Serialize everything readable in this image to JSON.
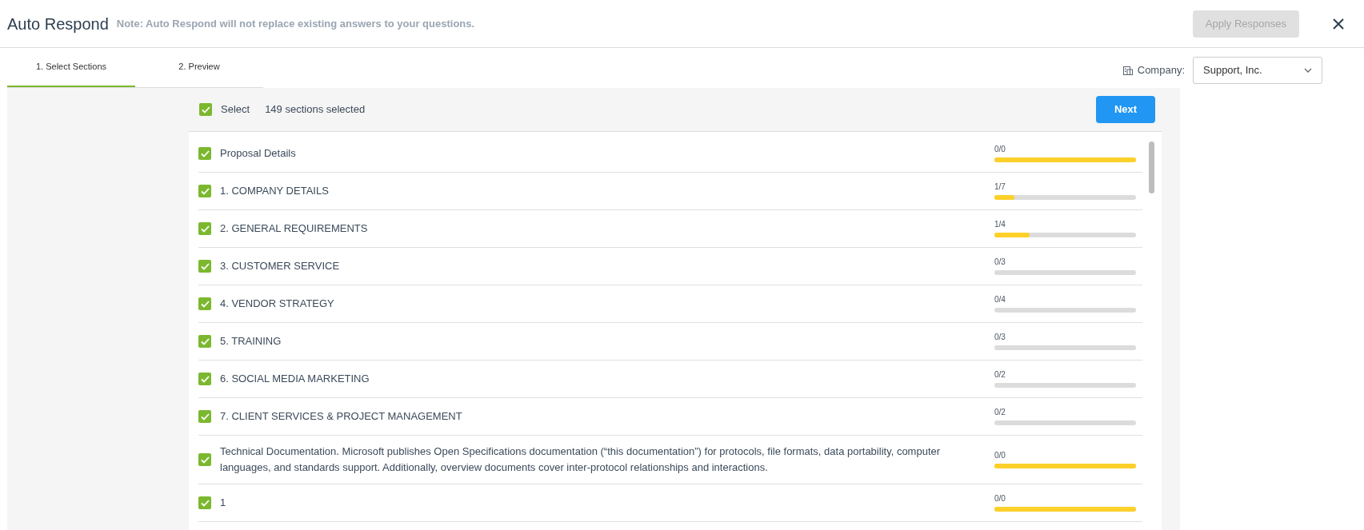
{
  "header": {
    "title": "Auto Respond",
    "note": "Note: Auto Respond will not replace existing answers to your questions.",
    "apply_button": {
      "label": "Apply Responses",
      "disabled": true
    }
  },
  "tabs": [
    {
      "label": "1. Select Sections",
      "selected": true
    },
    {
      "label": "2. Preview",
      "selected": false
    }
  ],
  "company": {
    "label": "Company:",
    "value": "Support, Inc."
  },
  "select_bar": {
    "label": "Select",
    "checked": true,
    "count": "149 sections selected",
    "next_button": "Next"
  },
  "sections": [
    {
      "title": "Proposal Details",
      "checked": true,
      "progress": "0/0",
      "level": 1
    },
    {
      "title": "1. COMPANY DETAILS",
      "checked": true,
      "progress": "1/7",
      "level": 0.14
    },
    {
      "title": "2. GENERAL REQUIREMENTS",
      "checked": true,
      "progress": "1/4",
      "level": 0.25
    },
    {
      "title": "3. CUSTOMER SERVICE",
      "checked": true,
      "progress": "0/3",
      "level": 0
    },
    {
      "title": "4. VENDOR STRATEGY",
      "checked": true,
      "progress": "0/4",
      "level": 0
    },
    {
      "title": "5. TRAINING",
      "checked": true,
      "progress": "0/3",
      "level": 0
    },
    {
      "title": "6. SOCIAL MEDIA MARKETING",
      "checked": true,
      "progress": "0/2",
      "level": 0
    },
    {
      "title": "7. CLIENT SERVICES & PROJECT MANAGEMENT",
      "checked": true,
      "progress": "0/2",
      "level": 0
    },
    {
      "title": "Technical Documentation. Microsoft publishes Open Specifications documentation (“this documentation”) for protocols, file formats, data portability, computer languages, and standards support. Additionally, overview documents cover inter-protocol relationships and interactions.",
      "checked": true,
      "progress": "0/0",
      "level": 1
    },
    {
      "title": "1",
      "checked": true,
      "progress": "0/0",
      "level": 1
    }
  ]
}
